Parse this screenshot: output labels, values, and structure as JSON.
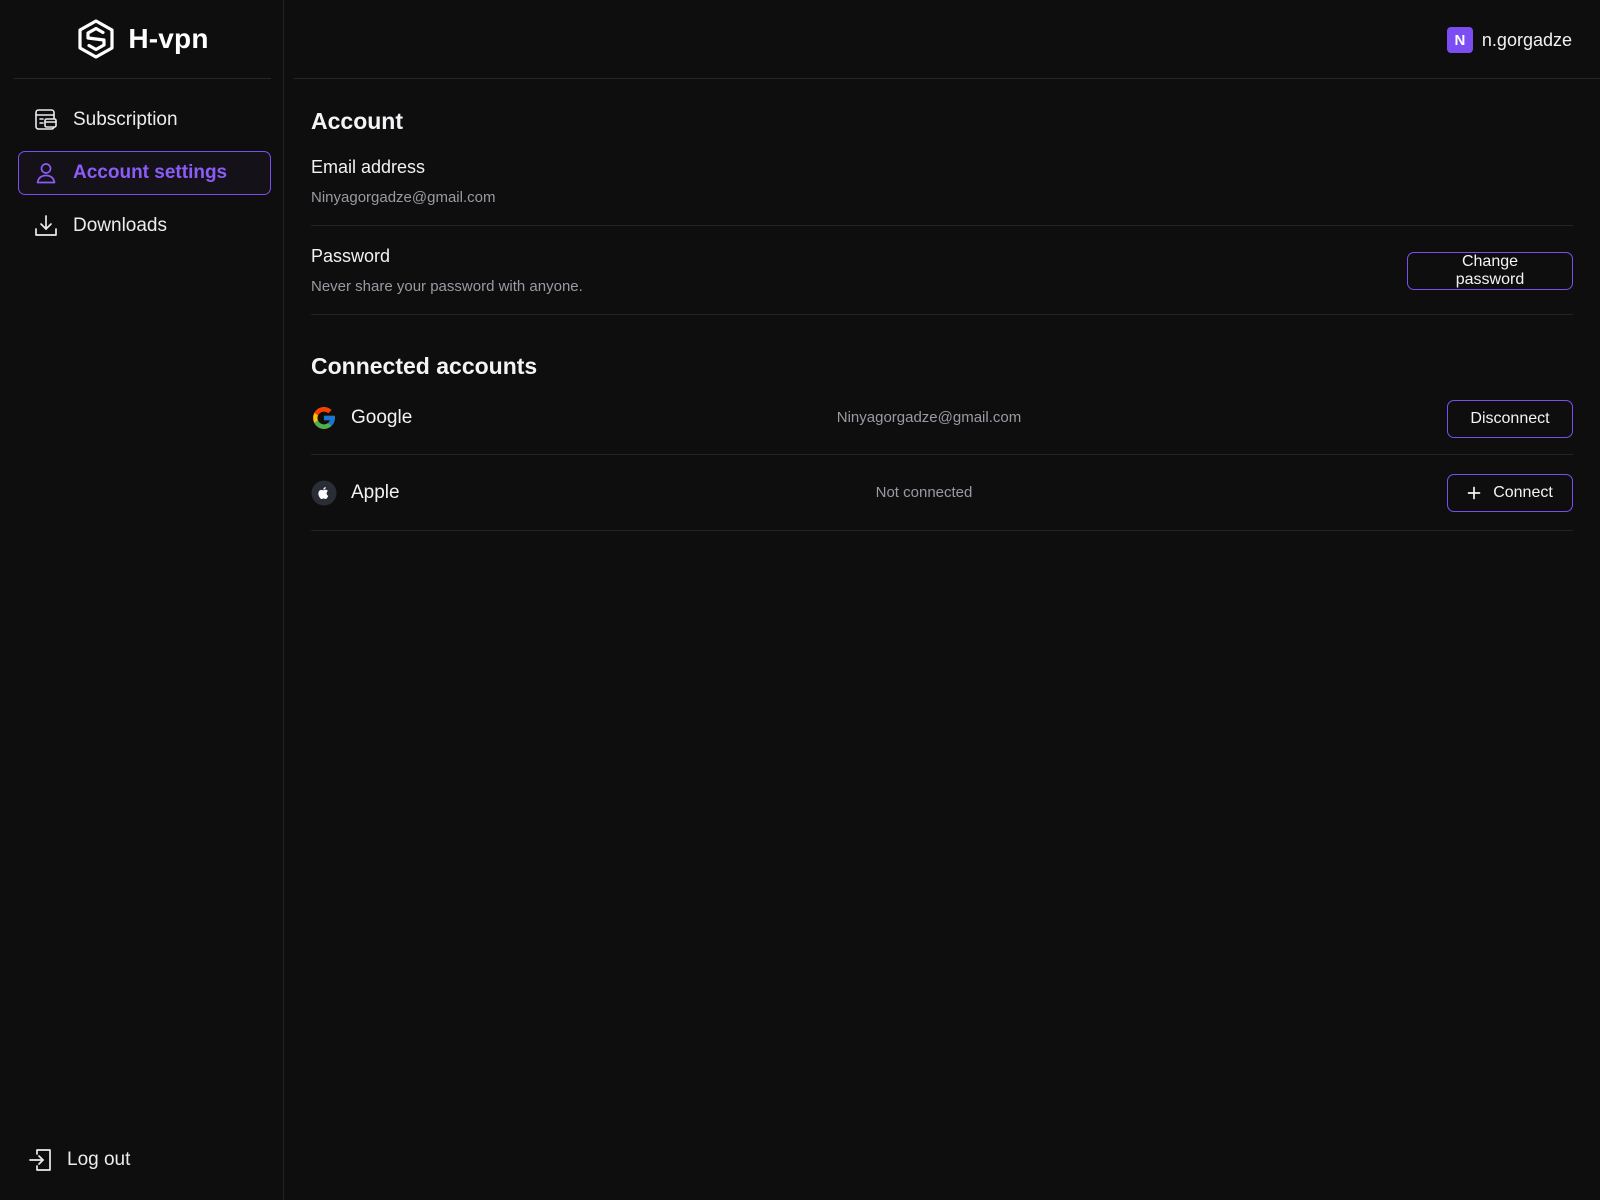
{
  "brand": {
    "name": "H-vpn"
  },
  "user": {
    "initial": "N",
    "username": "n.gorgadze"
  },
  "sidebar": {
    "items": [
      {
        "label": "Subscription",
        "icon": "subscription-icon",
        "active": false
      },
      {
        "label": "Account settings",
        "icon": "user-icon",
        "active": true
      },
      {
        "label": "Downloads",
        "icon": "download-icon",
        "active": false
      }
    ],
    "logout_label": "Log out"
  },
  "account": {
    "heading": "Account",
    "email_label": "Email address",
    "email_value": "Ninyagorgadze@gmail.com",
    "password_label": "Password",
    "password_hint": "Never share your password with anyone.",
    "change_password_label": "Change password"
  },
  "connected": {
    "heading": "Connected accounts",
    "providers": [
      {
        "name": "Google",
        "icon": "google-icon",
        "status": "Ninyagorgadze@gmail.com",
        "action": "Disconnect"
      },
      {
        "name": "Apple",
        "icon": "apple-icon",
        "status": "Not connected",
        "action": "Connect"
      }
    ]
  },
  "colors": {
    "background": "#0e0e0f",
    "accent": "#7a4ff0",
    "accent_text": "#8b5cf6",
    "muted_text": "#9a9aa2"
  }
}
